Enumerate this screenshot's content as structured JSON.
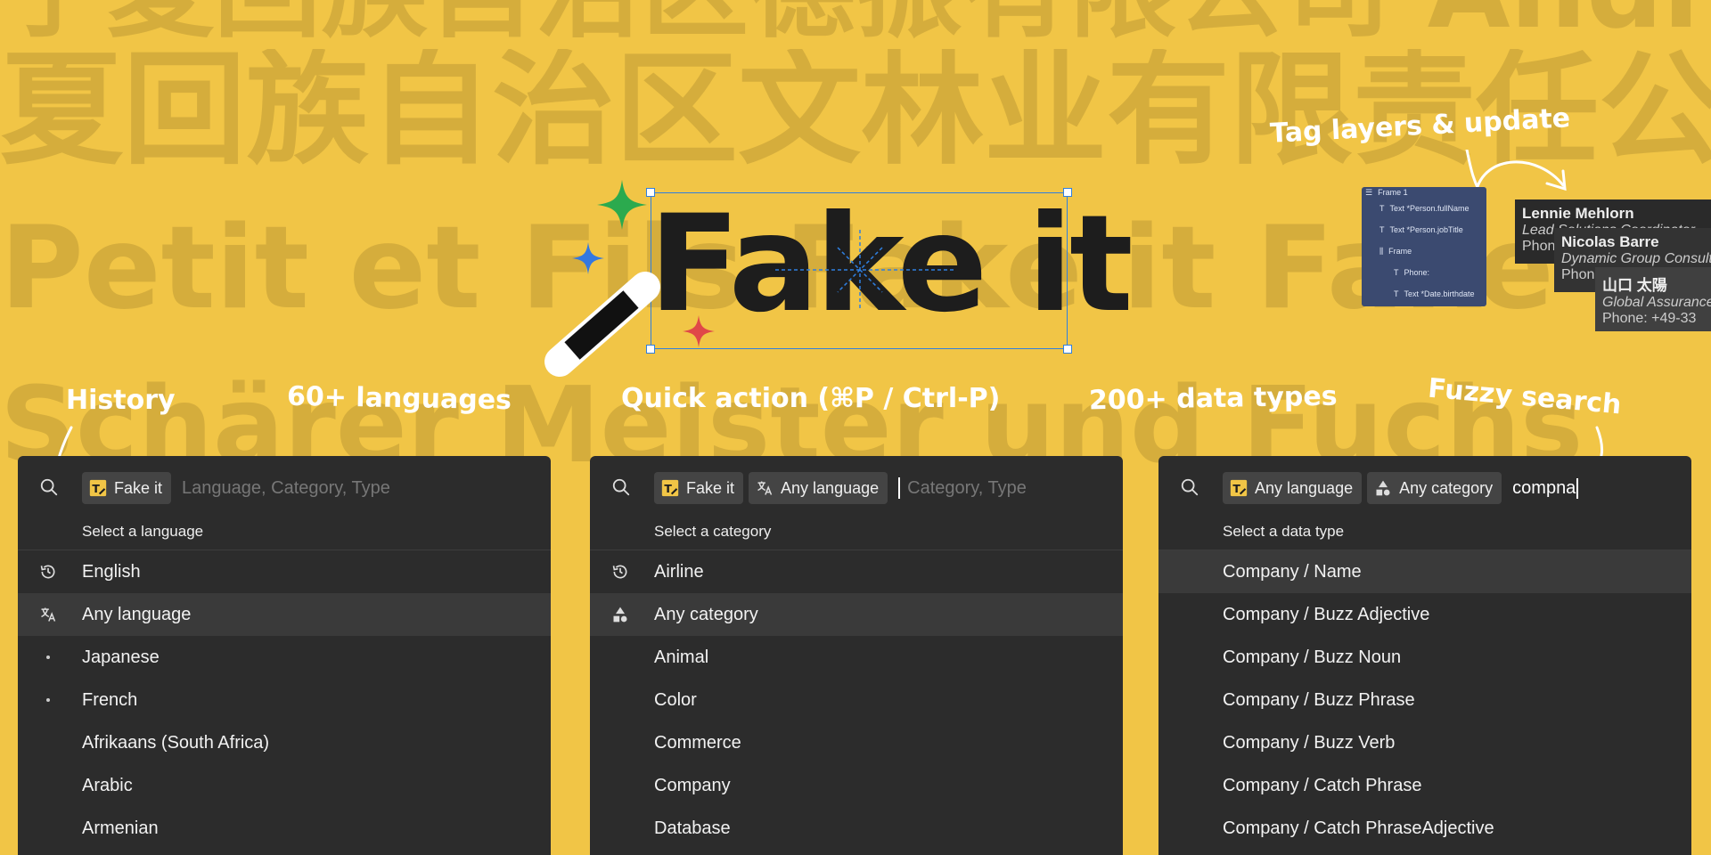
{
  "background": {
    "line1": "宁夏回族自治区德振有限公司 Andre, Lors",
    "line2": "夏回族自治区文林业有限责任公",
    "line3": "Petit et Fils   Fake it   Fake LLC",
    "line4": "Schärer  Meister und Fuchs"
  },
  "logo": {
    "text": "Fake it"
  },
  "annotations": {
    "tag_layers": "Tag layers & update",
    "history": "History",
    "languages": "60+ languages",
    "quick_action": "Quick action (⌘P / Ctrl-P)",
    "data_types": "200+ data types",
    "fuzzy_search": "Fuzzy search"
  },
  "layers_panel": {
    "items": [
      "Frame 1",
      "Text *Person.fullName",
      "Text *Person.jobTitle",
      "Frame",
      "Phone:",
      "Text *Date.birthdate"
    ]
  },
  "cards": [
    {
      "name": "Lennie Mehlorn",
      "title": "Lead Solutions Coordinator",
      "phone": "Phone:"
    },
    {
      "name": "Nicolas Barre",
      "title": "Dynamic Group Consultant",
      "phone": "Phone:"
    },
    {
      "name": "山口 太陽",
      "title": "Global Assurance",
      "phone": "Phone:  +49-33"
    }
  ],
  "panels": [
    {
      "chips": [
        {
          "label": "Fake it",
          "icon": "fake-it-logo-icon"
        }
      ],
      "placeholder": "Language, Category, Type",
      "typed": "",
      "section": "Select a language",
      "items": [
        {
          "label": "English",
          "icon": "history-icon",
          "highlight": false
        },
        {
          "label": "Any language",
          "icon": "translate-icon",
          "highlight": true
        },
        {
          "label": "Japanese",
          "icon": "dot-icon",
          "highlight": false
        },
        {
          "label": "French",
          "icon": "dot-icon",
          "highlight": false
        },
        {
          "label": "Afrikaans (South Africa)",
          "icon": "",
          "highlight": false
        },
        {
          "label": "Arabic",
          "icon": "",
          "highlight": false
        },
        {
          "label": "Armenian",
          "icon": "",
          "highlight": false
        }
      ]
    },
    {
      "chips": [
        {
          "label": "Fake it",
          "icon": "fake-it-logo-icon"
        },
        {
          "label": "Any language",
          "icon": "translate-icon"
        }
      ],
      "placeholder": "Category, Type",
      "typed": "",
      "section": "Select a category",
      "items": [
        {
          "label": "Airline",
          "icon": "history-icon",
          "highlight": false
        },
        {
          "label": "Any category",
          "icon": "shapes-icon",
          "highlight": true
        },
        {
          "label": "Animal",
          "icon": "",
          "highlight": false
        },
        {
          "label": "Color",
          "icon": "",
          "highlight": false
        },
        {
          "label": "Commerce",
          "icon": "",
          "highlight": false
        },
        {
          "label": "Company",
          "icon": "",
          "highlight": false
        },
        {
          "label": "Database",
          "icon": "",
          "highlight": false
        }
      ]
    },
    {
      "chips": [
        {
          "label": "Any language",
          "icon": "fake-it-logo-icon"
        },
        {
          "label": "Any category",
          "icon": "shapes-icon"
        }
      ],
      "placeholder": "",
      "typed": "compna",
      "section": "Select a data type",
      "items": [
        {
          "label": "Company / Name",
          "icon": "",
          "highlight": true
        },
        {
          "label": "Company / Buzz Adjective",
          "icon": "",
          "highlight": false
        },
        {
          "label": "Company / Buzz Noun",
          "icon": "",
          "highlight": false
        },
        {
          "label": "Company / Buzz Phrase",
          "icon": "",
          "highlight": false
        },
        {
          "label": "Company / Buzz Verb",
          "icon": "",
          "highlight": false
        },
        {
          "label": "Company / Catch Phrase",
          "icon": "",
          "highlight": false
        },
        {
          "label": "Company / Catch PhraseAdjective",
          "icon": "",
          "highlight": false
        }
      ]
    }
  ],
  "colors": {
    "background": "#F1C546",
    "panel": "#2C2C2C",
    "highlight": "#3A3A3A",
    "selection": "#2F7FE0",
    "sparkle_green": "#2BAA4E",
    "sparkle_blue": "#3478E0",
    "sparkle_red": "#E04848"
  }
}
